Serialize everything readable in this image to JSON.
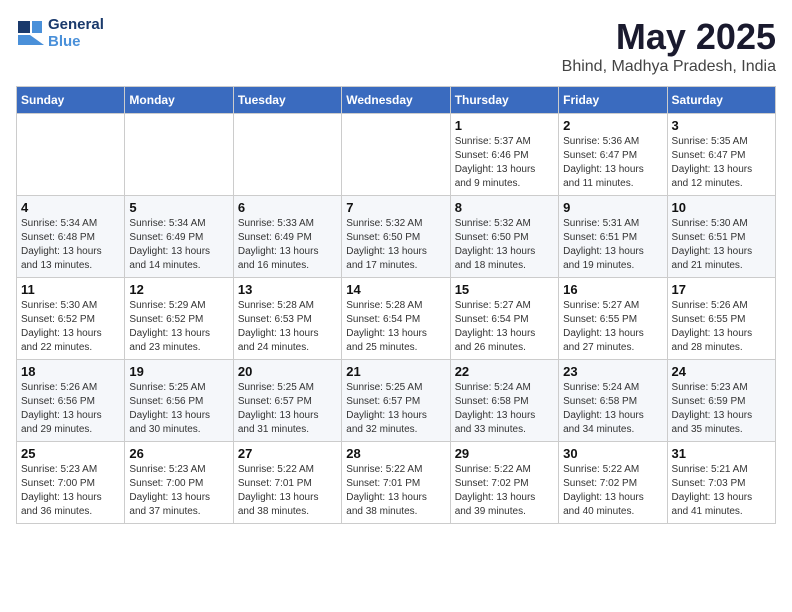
{
  "header": {
    "logo_line1": "General",
    "logo_line2": "Blue",
    "month_title": "May 2025",
    "location": "Bhind, Madhya Pradesh, India"
  },
  "weekdays": [
    "Sunday",
    "Monday",
    "Tuesday",
    "Wednesday",
    "Thursday",
    "Friday",
    "Saturday"
  ],
  "weeks": [
    [
      {
        "day": "",
        "info": ""
      },
      {
        "day": "",
        "info": ""
      },
      {
        "day": "",
        "info": ""
      },
      {
        "day": "",
        "info": ""
      },
      {
        "day": "1",
        "info": "Sunrise: 5:37 AM\nSunset: 6:46 PM\nDaylight: 13 hours\nand 9 minutes."
      },
      {
        "day": "2",
        "info": "Sunrise: 5:36 AM\nSunset: 6:47 PM\nDaylight: 13 hours\nand 11 minutes."
      },
      {
        "day": "3",
        "info": "Sunrise: 5:35 AM\nSunset: 6:47 PM\nDaylight: 13 hours\nand 12 minutes."
      }
    ],
    [
      {
        "day": "4",
        "info": "Sunrise: 5:34 AM\nSunset: 6:48 PM\nDaylight: 13 hours\nand 13 minutes."
      },
      {
        "day": "5",
        "info": "Sunrise: 5:34 AM\nSunset: 6:49 PM\nDaylight: 13 hours\nand 14 minutes."
      },
      {
        "day": "6",
        "info": "Sunrise: 5:33 AM\nSunset: 6:49 PM\nDaylight: 13 hours\nand 16 minutes."
      },
      {
        "day": "7",
        "info": "Sunrise: 5:32 AM\nSunset: 6:50 PM\nDaylight: 13 hours\nand 17 minutes."
      },
      {
        "day": "8",
        "info": "Sunrise: 5:32 AM\nSunset: 6:50 PM\nDaylight: 13 hours\nand 18 minutes."
      },
      {
        "day": "9",
        "info": "Sunrise: 5:31 AM\nSunset: 6:51 PM\nDaylight: 13 hours\nand 19 minutes."
      },
      {
        "day": "10",
        "info": "Sunrise: 5:30 AM\nSunset: 6:51 PM\nDaylight: 13 hours\nand 21 minutes."
      }
    ],
    [
      {
        "day": "11",
        "info": "Sunrise: 5:30 AM\nSunset: 6:52 PM\nDaylight: 13 hours\nand 22 minutes."
      },
      {
        "day": "12",
        "info": "Sunrise: 5:29 AM\nSunset: 6:52 PM\nDaylight: 13 hours\nand 23 minutes."
      },
      {
        "day": "13",
        "info": "Sunrise: 5:28 AM\nSunset: 6:53 PM\nDaylight: 13 hours\nand 24 minutes."
      },
      {
        "day": "14",
        "info": "Sunrise: 5:28 AM\nSunset: 6:54 PM\nDaylight: 13 hours\nand 25 minutes."
      },
      {
        "day": "15",
        "info": "Sunrise: 5:27 AM\nSunset: 6:54 PM\nDaylight: 13 hours\nand 26 minutes."
      },
      {
        "day": "16",
        "info": "Sunrise: 5:27 AM\nSunset: 6:55 PM\nDaylight: 13 hours\nand 27 minutes."
      },
      {
        "day": "17",
        "info": "Sunrise: 5:26 AM\nSunset: 6:55 PM\nDaylight: 13 hours\nand 28 minutes."
      }
    ],
    [
      {
        "day": "18",
        "info": "Sunrise: 5:26 AM\nSunset: 6:56 PM\nDaylight: 13 hours\nand 29 minutes."
      },
      {
        "day": "19",
        "info": "Sunrise: 5:25 AM\nSunset: 6:56 PM\nDaylight: 13 hours\nand 30 minutes."
      },
      {
        "day": "20",
        "info": "Sunrise: 5:25 AM\nSunset: 6:57 PM\nDaylight: 13 hours\nand 31 minutes."
      },
      {
        "day": "21",
        "info": "Sunrise: 5:25 AM\nSunset: 6:57 PM\nDaylight: 13 hours\nand 32 minutes."
      },
      {
        "day": "22",
        "info": "Sunrise: 5:24 AM\nSunset: 6:58 PM\nDaylight: 13 hours\nand 33 minutes."
      },
      {
        "day": "23",
        "info": "Sunrise: 5:24 AM\nSunset: 6:58 PM\nDaylight: 13 hours\nand 34 minutes."
      },
      {
        "day": "24",
        "info": "Sunrise: 5:23 AM\nSunset: 6:59 PM\nDaylight: 13 hours\nand 35 minutes."
      }
    ],
    [
      {
        "day": "25",
        "info": "Sunrise: 5:23 AM\nSunset: 7:00 PM\nDaylight: 13 hours\nand 36 minutes."
      },
      {
        "day": "26",
        "info": "Sunrise: 5:23 AM\nSunset: 7:00 PM\nDaylight: 13 hours\nand 37 minutes."
      },
      {
        "day": "27",
        "info": "Sunrise: 5:22 AM\nSunset: 7:01 PM\nDaylight: 13 hours\nand 38 minutes."
      },
      {
        "day": "28",
        "info": "Sunrise: 5:22 AM\nSunset: 7:01 PM\nDaylight: 13 hours\nand 38 minutes."
      },
      {
        "day": "29",
        "info": "Sunrise: 5:22 AM\nSunset: 7:02 PM\nDaylight: 13 hours\nand 39 minutes."
      },
      {
        "day": "30",
        "info": "Sunrise: 5:22 AM\nSunset: 7:02 PM\nDaylight: 13 hours\nand 40 minutes."
      },
      {
        "day": "31",
        "info": "Sunrise: 5:21 AM\nSunset: 7:03 PM\nDaylight: 13 hours\nand 41 minutes."
      }
    ]
  ]
}
